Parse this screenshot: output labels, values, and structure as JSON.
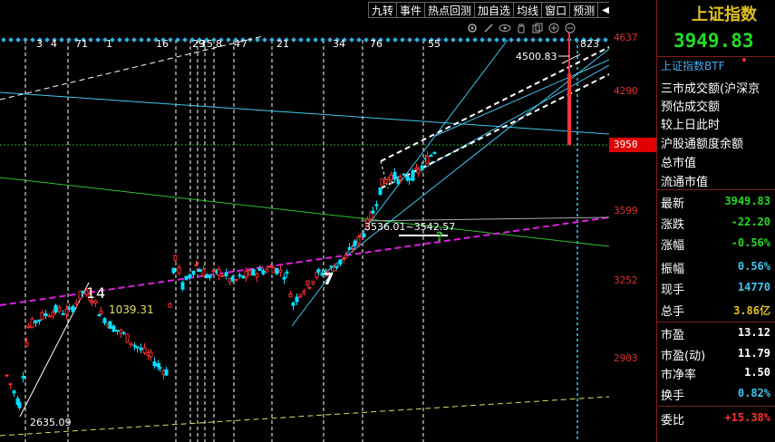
{
  "toolbar": {
    "items": [
      "九转",
      "事件",
      "热点回测",
      "加自选",
      "均线",
      "窗口",
      "预测"
    ],
    "arrow": "◀"
  },
  "tools": {
    "icons": [
      "settings-icon",
      "pencil-icon",
      "eye-icon",
      "hand-icon",
      "copy-icon",
      "zoom-in-icon",
      "zoom-out-icon"
    ]
  },
  "chart": {
    "top_markers": [
      "3",
      "4",
      "7",
      "1",
      "1",
      "16",
      "29",
      "3",
      "5",
      "8",
      "4",
      "7",
      "21",
      "34",
      "76",
      "55",
      "823"
    ],
    "annotations": {
      "high_label": "4500.83",
      "mid_label": "3536.01~3542.57",
      "left_label": "1039.31",
      "low_label": "2635.09",
      "wave_1": "1",
      "wave_4": "4",
      "wave_7": "7",
      "question": "?"
    },
    "colors": {
      "up": "#ff3030",
      "down": "#00e0ff",
      "trend_green": "#30c030",
      "purple": "#e020e0",
      "yellow": "#e0e060",
      "cyan": "#40c8f0"
    }
  },
  "price_axis": {
    "labels": [
      "4637",
      "4290",
      "3950",
      "3599",
      "3252",
      "2903"
    ],
    "current": "3950"
  },
  "side": {
    "title": "上证指数",
    "price": "3949.83",
    "link": "上证指数BTF",
    "info": [
      "三市成交额(沪深京",
      "预估成交额",
      "较上日此时",
      "沪股通额度余额",
      "总市值",
      "流通市值"
    ],
    "quotes": [
      {
        "label": "最新",
        "value": "3949.83",
        "color": "green"
      },
      {
        "label": "涨跌",
        "value": "-22.20",
        "color": "green"
      },
      {
        "label": "涨幅",
        "value": "-0.56%",
        "color": "green"
      },
      {
        "label": "振幅",
        "value": "0.56%",
        "color": "cyan"
      },
      {
        "label": "现手",
        "value": "14770",
        "color": "cyan"
      },
      {
        "label": "总手",
        "value": "3.86亿",
        "color": "yellow"
      },
      {
        "label": "市盈",
        "value": "13.12",
        "color": "white"
      },
      {
        "label": "市盈(动)",
        "value": "11.79",
        "color": "white"
      },
      {
        "label": "市净率",
        "value": "1.50",
        "color": "white"
      },
      {
        "label": "换手",
        "value": "0.82%",
        "color": "cyan"
      },
      {
        "label": "委比",
        "value": "+15.38%",
        "color": "red"
      }
    ]
  }
}
